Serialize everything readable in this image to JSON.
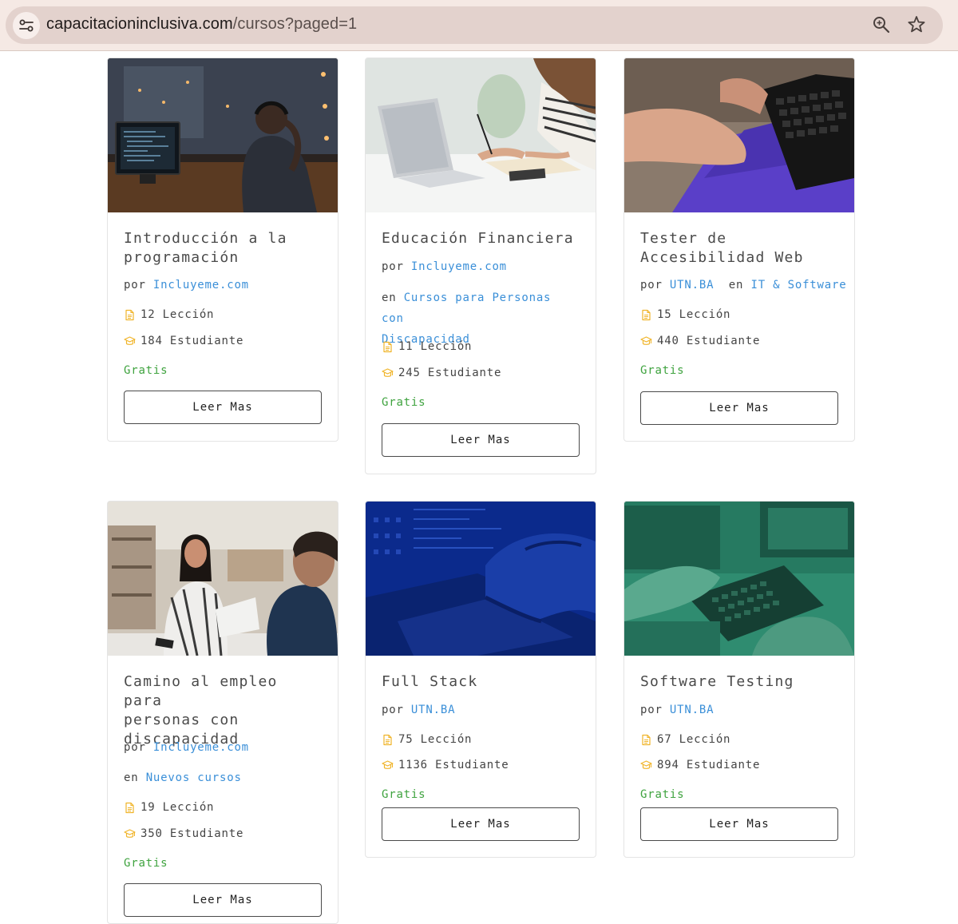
{
  "browser": {
    "url_host": "capacitacioninclusiva.com",
    "url_path": "/cursos?paged=1"
  },
  "labels": {
    "by": "por",
    "in": "en",
    "lessons_suffix": "Lección",
    "students_suffix": "Estudiante",
    "price": "Gratis",
    "cta": "Leer Mas"
  },
  "courses": [
    {
      "title_lines": [
        "Introducción a la",
        "programación"
      ],
      "author": "Incluyeme.com",
      "category": "",
      "lessons": "12 Lección",
      "students": "184 Estudiante",
      "price": "Gratis",
      "cta": "Leer Mas"
    },
    {
      "title_lines": [
        "Educación Financiera"
      ],
      "author": "Incluyeme.com",
      "category_lines": [
        "Cursos para Personas con",
        "Discapacidad"
      ],
      "lessons": "11 Lección",
      "students": "245 Estudiante",
      "price": "Gratis",
      "cta": "Leer Mas"
    },
    {
      "title_lines": [
        "Tester de",
        "Accesibilidad Web"
      ],
      "author": "UTN.BA",
      "category": "IT & Software",
      "lessons": "15 Lección",
      "students": "440 Estudiante",
      "price": "Gratis",
      "cta": "Leer Mas"
    },
    {
      "title_lines": [
        "Camino al empleo para",
        "personas con",
        "discapacidad"
      ],
      "author": "Incluyeme.com",
      "category": "Nuevos cursos",
      "lessons": "19 Lección",
      "students": "350 Estudiante",
      "price": "Gratis",
      "cta": "Leer Mas"
    },
    {
      "title_lines": [
        "Full Stack"
      ],
      "author": "UTN.BA",
      "category": "",
      "lessons": "75 Lección",
      "students": "1136 Estudiante",
      "price": "Gratis",
      "cta": "Leer Mas"
    },
    {
      "title_lines": [
        "Software Testing"
      ],
      "author": "UTN.BA",
      "category": "",
      "lessons": "67 Lección",
      "students": "894 Estudiante",
      "price": "Gratis",
      "cta": "Leer Mas"
    }
  ],
  "colors": {
    "link": "#3a8fd8",
    "price": "#3fa33f",
    "icon": "#f0b429",
    "browser_bar": "#f5e9e4",
    "omnibox": "#e3d2cd"
  },
  "icons": {
    "lessons": "document-icon",
    "students": "graduation-cap-icon",
    "site_info": "tune-icon",
    "zoom": "zoom-icon",
    "bookmark": "star-icon"
  }
}
